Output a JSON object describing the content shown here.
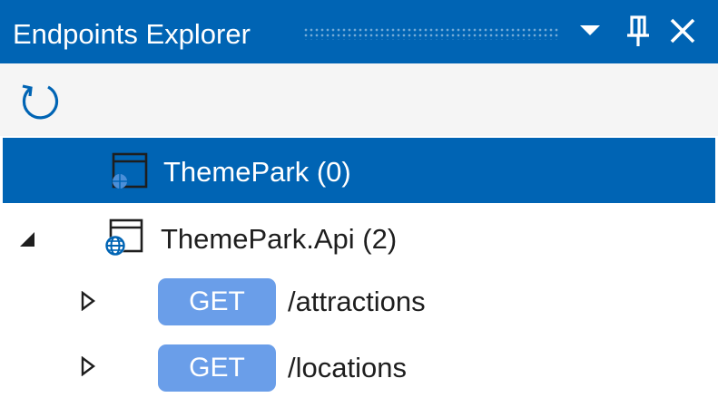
{
  "window": {
    "title": "Endpoints Explorer",
    "buttons": [
      {
        "name": "dropdown",
        "icon": "chevron-down-icon"
      },
      {
        "name": "pin",
        "icon": "pin-icon"
      },
      {
        "name": "close",
        "icon": "close-icon"
      }
    ]
  },
  "toolbar": {
    "refresh_icon": "refresh-icon"
  },
  "tree": {
    "projects": [
      {
        "label": "ThemePark (0)",
        "selected": true,
        "expanded": false,
        "icon": "project-window-icon"
      },
      {
        "label": "ThemePark.Api (2)",
        "selected": false,
        "expanded": true,
        "icon": "web-project-globe-icon"
      }
    ],
    "endpoints": [
      {
        "method": "GET",
        "path": "/attractions",
        "expanded": false
      },
      {
        "method": "GET",
        "path": "/locations",
        "expanded": false
      }
    ]
  },
  "colors": {
    "accent": "#0064b4",
    "selection": "#0064b4",
    "method_get": "#6a9ee9",
    "text": "#1e1e1e",
    "toolbar_bg": "#f5f5f5"
  }
}
